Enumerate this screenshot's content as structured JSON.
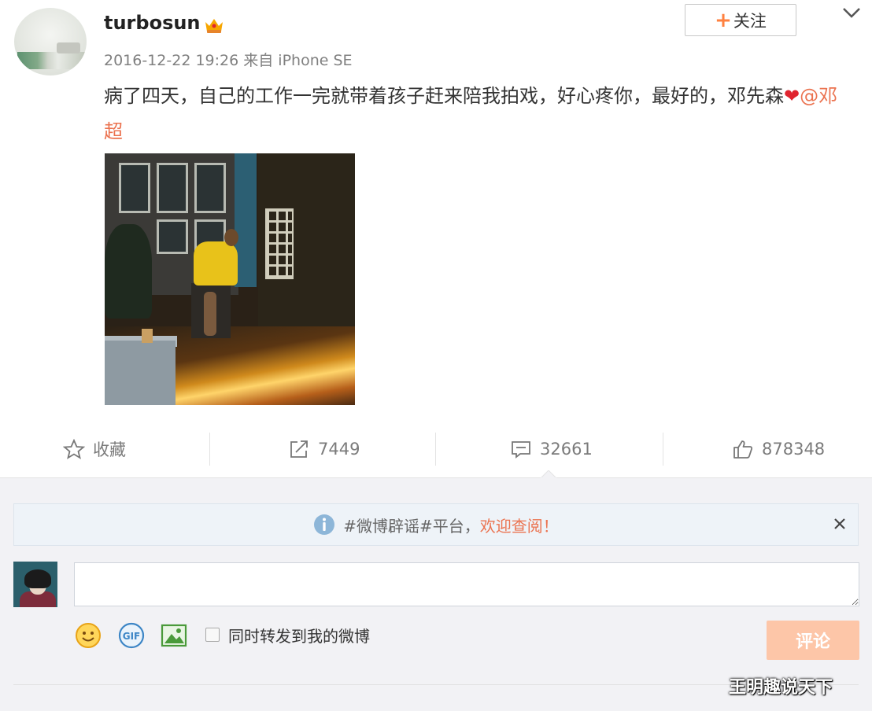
{
  "post": {
    "username": "turbosun",
    "follow_label": "关注",
    "follow_plus": "+",
    "meta": "2016-12-22 19:26 来自 iPhone SE",
    "text_main": "病了四天，自己的工作一完就带着孩子赶来陪我拍戏，好心疼你，最好的，邓先森",
    "heart": "❤",
    "mention": "@邓超"
  },
  "actions": {
    "favorite_label": "收藏",
    "repost_count": "7449",
    "comment_count": "32661",
    "like_count": "878348"
  },
  "comment_box": {
    "notice_text": "#微博辟谣#平台，",
    "notice_link": "欢迎查阅！",
    "close_symbol": "×",
    "input_value": "",
    "repost_checkbox_label": "同时转发到我的微博",
    "submit_label": "评论"
  },
  "watermark": "王明趣说天下",
  "colors": {
    "accent_orange": "#eb7350",
    "submit_disabled": "#fdc6a8",
    "panel_bg": "#f2f2f5"
  }
}
